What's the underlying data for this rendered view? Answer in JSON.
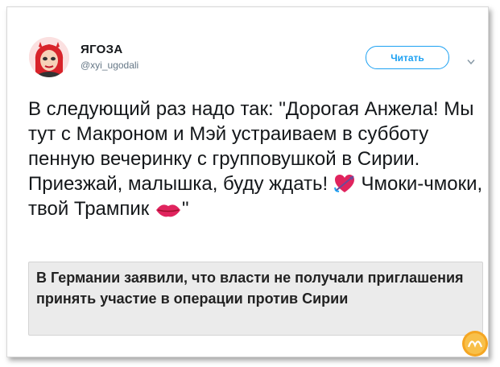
{
  "author": {
    "display_name": "ЯГОЗА",
    "handle": "@xyi_ugodali"
  },
  "follow_button": {
    "label": "Читать"
  },
  "tweet": {
    "line_part_1": "В следующий раз надо так: \"Дорогая Анжела! Мы тут с Макроном и Мэй устраиваем в субботу пенную вечеринку с групповушкой в Сирии. Приезжай, малышка, буду ждать! ",
    "line_part_2": " Чмоки-чмоки, твой Трампик ",
    "line_part_3": "\""
  },
  "link_card": {
    "title": "В Германии заявили, что власти не получали приглашения принять участие в операции против Сирии"
  },
  "icons": {
    "heart": "heart-arrow-icon",
    "kiss": "kiss-lips-icon",
    "menu": "chevron-down-icon"
  },
  "colors": {
    "accent": "#1da1f2",
    "text": "#14171a",
    "secondary": "#657786",
    "card_bg": "#ebebeb"
  }
}
